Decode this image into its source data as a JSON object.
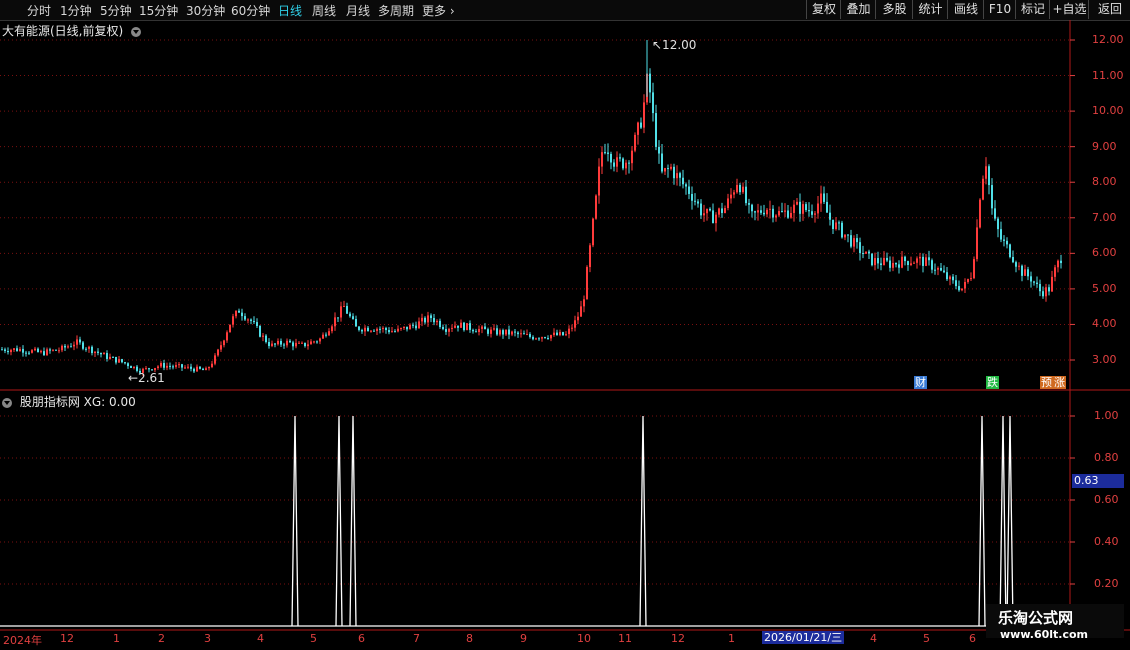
{
  "toolbar": {
    "periods": [
      "分时",
      "1分钟",
      "5分钟",
      "15分钟",
      "30分钟",
      "60分钟",
      "日线",
      "周线",
      "月线",
      "多周期",
      "更多"
    ],
    "active_period": "日线",
    "buttons": [
      "复权",
      "叠加",
      "多股",
      "统计",
      "画线",
      "F10",
      "标记",
      "+自选",
      "返回"
    ]
  },
  "main_title": "大有能源(日线,前复权)",
  "sub_title": "股朋指标网 XG: 0.00",
  "markers": {
    "high": "12.00",
    "low": "2.61"
  },
  "event_tags": [
    {
      "text": "财",
      "color": "#3a7bd5"
    },
    {
      "text": "跌",
      "color": "#22bb44"
    },
    {
      "text": "预",
      "color": "#d06a20"
    },
    {
      "text": "涨",
      "color": "#d06a20"
    }
  ],
  "current_value": "0.63",
  "x_axis": {
    "labels": [
      "2024年",
      "12",
      "1",
      "2",
      "3",
      "4",
      "5",
      "6",
      "7",
      "8",
      "9",
      "10",
      "11",
      "12",
      "1",
      "2026/01/21/三",
      "4",
      "5",
      "6"
    ],
    "highlight": "2026/01/21/三"
  },
  "watermark": {
    "line1": "乐淘公式网",
    "line2": "www.60lt.com"
  },
  "colors": {
    "up": "#ff3b3b",
    "down": "#50e0e8",
    "grid": "#7a1010",
    "axis": "#e04040",
    "signal": "#ffffff"
  },
  "chart_data": [
    {
      "type": "candlestick",
      "title": "大有能源(日线,前复权)",
      "ylim": [
        2.3,
        12.4
      ],
      "yticks": [
        "12.00",
        "11.00",
        "10.00",
        "9.00",
        "8.00",
        "7.00",
        "6.00",
        "5.00",
        "4.00",
        "3.00"
      ],
      "annotations": {
        "max": 12.0,
        "min": 2.61
      },
      "close_trend": [
        [
          0,
          3.3
        ],
        [
          20,
          3.3
        ],
        [
          40,
          3.2
        ],
        [
          60,
          3.3
        ],
        [
          75,
          3.5
        ],
        [
          90,
          3.3
        ],
        [
          105,
          3.1
        ],
        [
          125,
          2.9
        ],
        [
          140,
          2.7
        ],
        [
          160,
          2.85
        ],
        [
          180,
          2.8
        ],
        [
          205,
          2.7
        ],
        [
          215,
          3.1
        ],
        [
          230,
          4.1
        ],
        [
          238,
          4.4
        ],
        [
          250,
          4.1
        ],
        [
          260,
          3.7
        ],
        [
          270,
          3.4
        ],
        [
          285,
          3.5
        ],
        [
          300,
          3.4
        ],
        [
          320,
          3.6
        ],
        [
          335,
          4.2
        ],
        [
          343,
          4.5
        ],
        [
          355,
          3.9
        ],
        [
          375,
          3.9
        ],
        [
          395,
          3.8
        ],
        [
          415,
          4.0
        ],
        [
          430,
          4.2
        ],
        [
          445,
          3.9
        ],
        [
          455,
          4.0
        ],
        [
          470,
          3.9
        ],
        [
          490,
          3.8
        ],
        [
          510,
          3.75
        ],
        [
          530,
          3.65
        ],
        [
          550,
          3.7
        ],
        [
          565,
          3.7
        ],
        [
          575,
          4.1
        ],
        [
          582,
          4.6
        ],
        [
          588,
          5.9
        ],
        [
          595,
          7.5
        ],
        [
          600,
          8.8
        ],
        [
          605,
          9.1
        ],
        [
          615,
          8.5
        ],
        [
          625,
          8.6
        ],
        [
          635,
          9.2
        ],
        [
          642,
          10.0
        ],
        [
          647,
          11.0
        ],
        [
          652,
          9.8
        ],
        [
          660,
          8.2
        ],
        [
          670,
          8.4
        ],
        [
          680,
          8.0
        ],
        [
          690,
          7.7
        ],
        [
          700,
          7.2
        ],
        [
          710,
          7.0
        ],
        [
          725,
          7.3
        ],
        [
          737,
          8.1
        ],
        [
          750,
          7.0
        ],
        [
          765,
          7.3
        ],
        [
          780,
          7.1
        ],
        [
          795,
          7.3
        ],
        [
          810,
          7.2
        ],
        [
          820,
          7.5
        ],
        [
          830,
          6.9
        ],
        [
          845,
          6.5
        ],
        [
          855,
          6.2
        ],
        [
          870,
          5.8
        ],
        [
          890,
          5.7
        ],
        [
          905,
          5.8
        ],
        [
          920,
          5.8
        ],
        [
          935,
          5.6
        ],
        [
          950,
          5.2
        ],
        [
          962,
          5.0
        ],
        [
          970,
          5.4
        ],
        [
          975,
          6.4
        ],
        [
          980,
          8.0
        ],
        [
          985,
          8.6
        ],
        [
          992,
          7.0
        ],
        [
          1000,
          6.4
        ],
        [
          1010,
          6.0
        ],
        [
          1020,
          5.5
        ],
        [
          1030,
          5.3
        ],
        [
          1040,
          4.9
        ],
        [
          1048,
          5.0
        ],
        [
          1055,
          5.6
        ],
        [
          1062,
          6.0
        ]
      ]
    },
    {
      "type": "line",
      "title": "股朋指标网 XG: 0.00",
      "series": [
        {
          "name": "XG",
          "values": []
        }
      ],
      "ylim": [
        0,
        1.05
      ],
      "yticks": [
        "1.00",
        "0.80",
        "0.60",
        "0.40",
        "0.20"
      ],
      "signals_x": [
        295,
        339,
        353,
        643,
        982,
        1003,
        1010
      ]
    }
  ]
}
